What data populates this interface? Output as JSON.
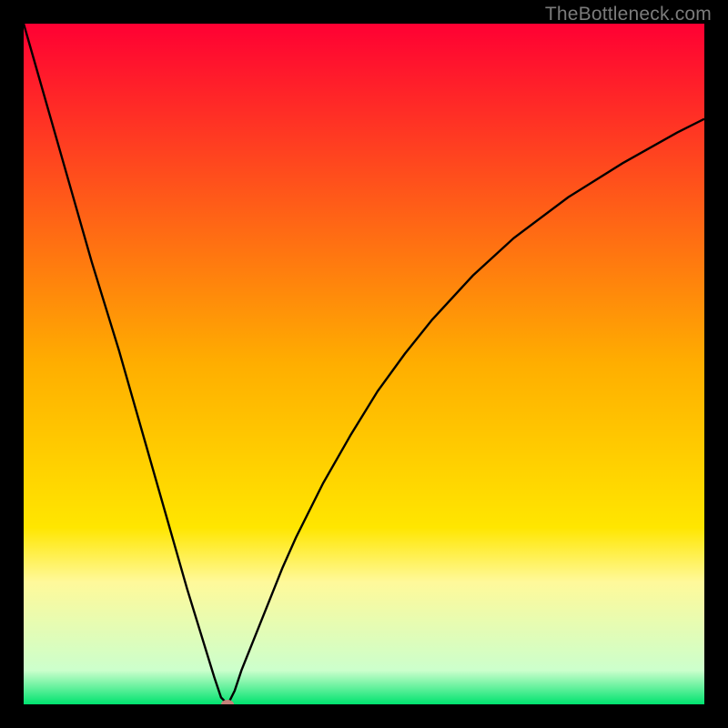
{
  "watermark": "TheBottleneck.com",
  "chart_data": {
    "type": "line",
    "title": "",
    "xlabel": "",
    "ylabel": "",
    "xlim": [
      0,
      100
    ],
    "ylim": [
      0,
      100
    ],
    "grid": false,
    "legend": false,
    "background": {
      "type": "vertical-gradient",
      "stops": [
        {
          "offset": 0,
          "color": "#ff0033"
        },
        {
          "offset": 50,
          "color": "#ffae00"
        },
        {
          "offset": 74,
          "color": "#ffe600"
        },
        {
          "offset": 82,
          "color": "#fff99a"
        },
        {
          "offset": 95,
          "color": "#ccffcc"
        },
        {
          "offset": 100,
          "color": "#00e36f"
        }
      ]
    },
    "series": [
      {
        "name": "bottleneck-curve",
        "color": "#000000",
        "x": [
          0,
          2,
          4,
          6,
          8,
          10,
          12,
          14,
          16,
          18,
          20,
          22,
          24,
          26,
          28,
          29,
          30,
          31,
          32,
          34,
          36,
          38,
          40,
          44,
          48,
          52,
          56,
          60,
          66,
          72,
          80,
          88,
          96,
          100
        ],
        "y": [
          100,
          93,
          86,
          79,
          72,
          65,
          58.5,
          52,
          45,
          38,
          31,
          24,
          17,
          10.5,
          4,
          1,
          0,
          2,
          5,
          10,
          15,
          20,
          24.5,
          32.5,
          39.5,
          46,
          51.5,
          56.5,
          63,
          68.5,
          74.5,
          79.5,
          84,
          86
        ]
      }
    ],
    "markers": [
      {
        "name": "min-point",
        "x": 30,
        "y": 0,
        "color": "#c58079"
      }
    ]
  }
}
